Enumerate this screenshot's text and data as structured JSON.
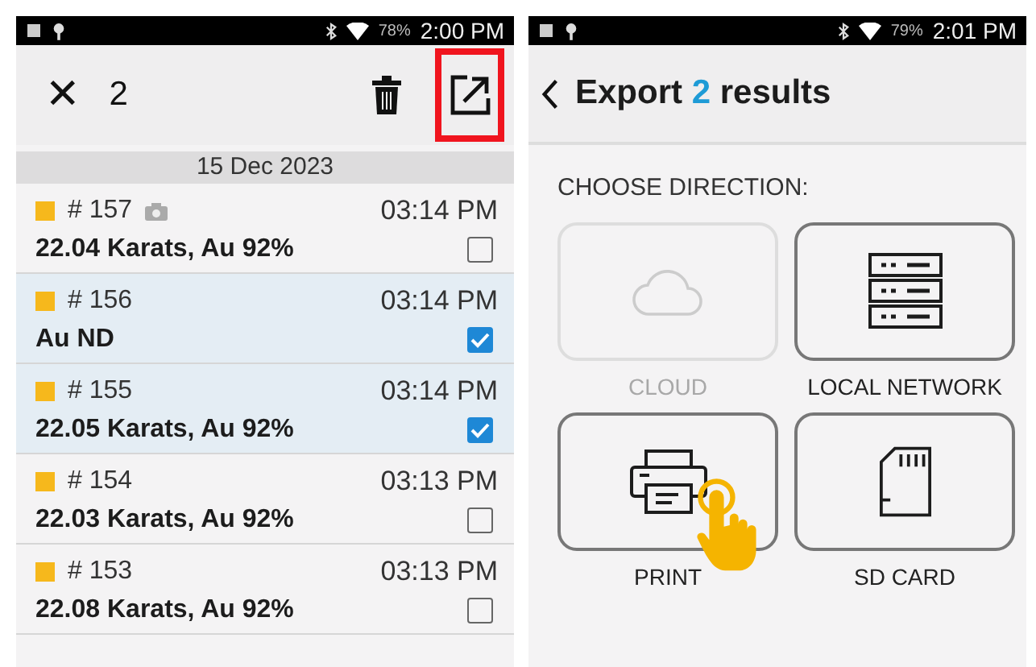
{
  "history_screen": {
    "status_bar": {
      "battery": "78%",
      "time": "2:00 PM"
    },
    "toolbar": {
      "close": "✕",
      "selected_count": "2",
      "export_highlighted": true
    },
    "date_header": "15 Dec 2023",
    "results": [
      {
        "number": "# 157",
        "time": "03:14 PM",
        "value": "22.04 Karats, Au 92%",
        "photo": true,
        "selected": false,
        "color": "#f6b81c"
      },
      {
        "number": "# 156",
        "time": "03:14 PM",
        "value": "Au ND",
        "photo": false,
        "selected": true,
        "color": "#f6b81c"
      },
      {
        "number": "# 155",
        "time": "03:14 PM",
        "value": "22.05 Karats, Au 92%",
        "photo": false,
        "selected": true,
        "color": "#f6b81c"
      },
      {
        "number": "# 154",
        "time": "03:13 PM",
        "value": "22.03 Karats, Au 92%",
        "photo": false,
        "selected": false,
        "color": "#f6b81c"
      },
      {
        "number": "# 153",
        "time": "03:13 PM",
        "value": "22.08 Karats, Au 92%",
        "photo": false,
        "selected": false,
        "color": "#f6b81c"
      }
    ]
  },
  "export_screen": {
    "status_bar": {
      "battery": "79%",
      "time": "2:01 PM"
    },
    "title": {
      "before": "Export",
      "count": "2",
      "after": "results"
    },
    "section_label": "CHOOSE DIRECTION:",
    "options": [
      {
        "kind": "cloud",
        "label": "CLOUD",
        "disabled": true,
        "tapped": false
      },
      {
        "kind": "network",
        "label": "LOCAL NETWORK",
        "disabled": false,
        "tapped": false
      },
      {
        "kind": "print",
        "label": "PRINT",
        "disabled": false,
        "tapped": true
      },
      {
        "kind": "sdcard",
        "label": "SD CARD",
        "disabled": false,
        "tapped": false
      }
    ]
  }
}
